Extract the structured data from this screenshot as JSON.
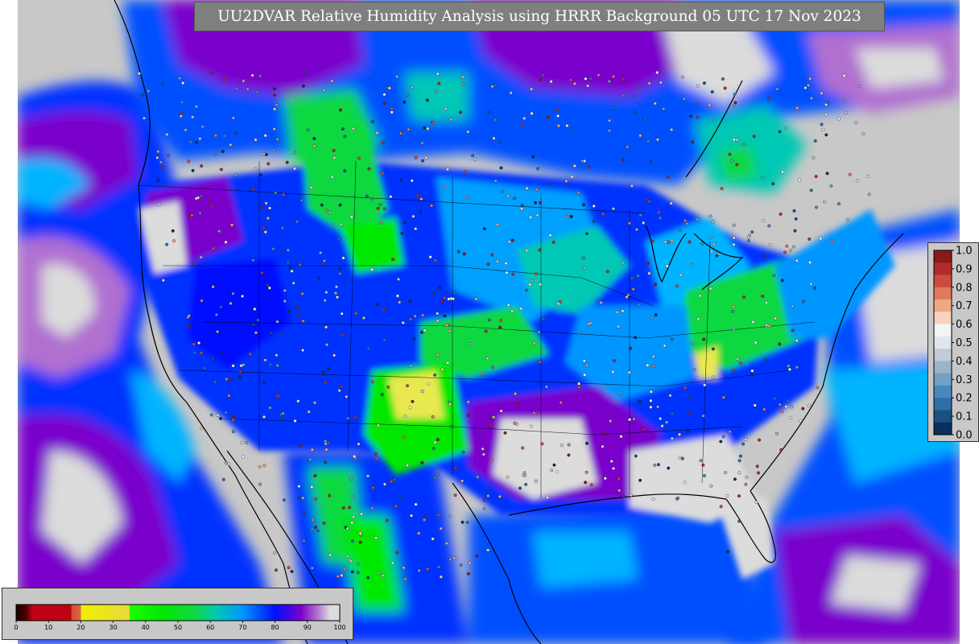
{
  "title": "UU2DVAR Relative Humidity Analysis using HRRR Background 05 UTC 17 Nov 2023",
  "rh_colorbar": {
    "ticks": [
      "0",
      "10",
      "20",
      "30",
      "40",
      "50",
      "60",
      "70",
      "80",
      "90",
      "100"
    ],
    "range": [
      0,
      100
    ],
    "stops": [
      {
        "v": 0,
        "c": "#1a0000"
      },
      {
        "v": 3,
        "c": "#4a0000"
      },
      {
        "v": 5,
        "c": "#c00014"
      },
      {
        "v": 17,
        "c": "#c00014"
      },
      {
        "v": 17.1,
        "c": "#d84a2a"
      },
      {
        "v": 20,
        "c": "#d86a4a"
      },
      {
        "v": 20.1,
        "c": "#f0f000"
      },
      {
        "v": 35,
        "c": "#e8d840"
      },
      {
        "v": 35.1,
        "c": "#1cff00"
      },
      {
        "v": 45,
        "c": "#00e800"
      },
      {
        "v": 55,
        "c": "#10d840"
      },
      {
        "v": 62,
        "c": "#00c8b4"
      },
      {
        "v": 70,
        "c": "#0096ff"
      },
      {
        "v": 80,
        "c": "#0010ff"
      },
      {
        "v": 88,
        "c": "#7a00cc"
      },
      {
        "v": 93,
        "c": "#b070d0"
      },
      {
        "v": 97,
        "c": "#dcdcdc"
      },
      {
        "v": 100,
        "c": "#dcdcdc"
      }
    ]
  },
  "score_legend": {
    "labels": [
      "1.0",
      "0.9",
      "0.8",
      "0.7",
      "0.6",
      "0.5",
      "0.4",
      "0.3",
      "0.2",
      "0.1",
      "0.0"
    ],
    "colors_top_to_bottom": [
      "#8b1a1a",
      "#b22b2b",
      "#cc4c3c",
      "#e07a5c",
      "#f0a882",
      "#f8d4c0",
      "#f4f4f4",
      "#e2e6ec",
      "#c0ccd8",
      "#9cb4c8",
      "#72a2c4",
      "#4a88bc",
      "#2f6ea8",
      "#1a4f80",
      "#08305a"
    ]
  },
  "map_colors": {
    "background": "#c8c8c8",
    "ocean_purple": "#7a00cc",
    "blue": "#0010ff",
    "light_blue": "#0096ff",
    "teal": "#00b4a0",
    "green": "#10d840",
    "yellow": "#e8e850"
  }
}
